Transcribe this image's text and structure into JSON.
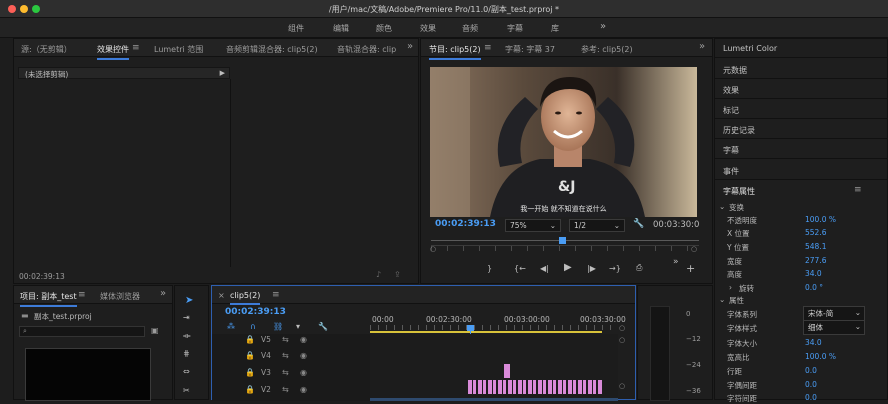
{
  "window": {
    "title": "/用户/mac/文稿/Adobe/Premiere Pro/11.0/副本_test.prproj *"
  },
  "workspaces": [
    "组件",
    "编辑",
    "颜色",
    "效果",
    "音频",
    "字幕",
    "库"
  ],
  "workspaces_more": "»",
  "source_panel": {
    "tabs": [
      "源:（无剪辑）",
      "效果控件",
      "Lumetri 范围",
      "音频剪辑混合器: clip5(2)",
      "音轨混合器: clip"
    ],
    "menu_glyph": "≡",
    "more": "»",
    "clip_row": "(未选择剪辑)",
    "timecode": "00:02:39:13"
  },
  "program_panel": {
    "tabs": [
      "节目: clip5(2)",
      "字幕: 字幕 37",
      "参考: clip5(2)"
    ],
    "menu_glyph": "≡",
    "subtitle": "我一开始 就不知道在说什么",
    "timecode_current": "00:02:39:13",
    "zoom": "75%",
    "resolution": "1/2",
    "timecode_duration": "00:03:30:0",
    "playhead_fraction": 0.49
  },
  "right_panel": {
    "items": [
      "Lumetri Color",
      "元数据",
      "效果",
      "标记",
      "历史记录",
      "字幕",
      "事件"
    ],
    "section_title": "字幕属性",
    "menu_glyph": "≡",
    "transform_label": "变换",
    "properties_label": "属性",
    "transform_props": [
      {
        "label": "不透明度",
        "value": "100.0 %"
      },
      {
        "label": "X 位置",
        "value": "552.6"
      },
      {
        "label": "Y 位置",
        "value": "548.1"
      },
      {
        "label": "宽度",
        "value": "277.6"
      },
      {
        "label": "高度",
        "value": "34.0"
      },
      {
        "label": "旋转",
        "value": "0.0 °"
      }
    ],
    "font_family": {
      "label": "字体系列",
      "value": "宋体-简"
    },
    "font_style": {
      "label": "字体样式",
      "value": "细体"
    },
    "other_props": [
      {
        "label": "字体大小",
        "value": "34.0"
      },
      {
        "label": "宽高比",
        "value": "100.0 %"
      },
      {
        "label": "行距",
        "value": "0.0"
      },
      {
        "label": "字偶间距",
        "value": "0.0"
      },
      {
        "label": "字符间距",
        "value": "0.0"
      }
    ]
  },
  "project_panel": {
    "tabs": [
      "项目: 副本_test",
      "媒体浏览器"
    ],
    "menu_glyph": "≡",
    "more": "»",
    "file": "副本_test.prproj"
  },
  "timeline": {
    "tab": "clip5(2)",
    "close_glyph": "×",
    "menu_glyph": "≡",
    "timecode": "00:02:39:13",
    "ruler": [
      "00:00",
      "00:02:30:00",
      "00:03:00:00",
      "00:03:30:00"
    ],
    "tracks": [
      "V5",
      "V4",
      "V3",
      "V2"
    ]
  },
  "meter": {
    "ticks": [
      "0",
      "−12",
      "−24",
      "−36"
    ]
  }
}
